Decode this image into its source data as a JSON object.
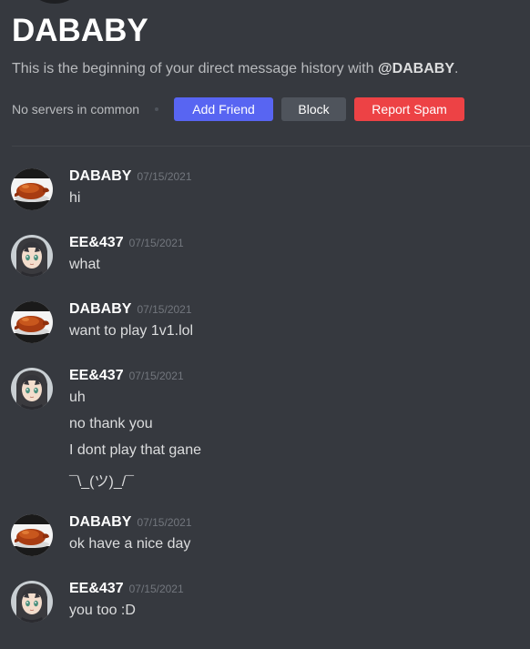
{
  "intro": {
    "title": "DABABY",
    "description_prefix": "This is the beginning of your direct message history with ",
    "mention": "@DABABY",
    "description_suffix": "."
  },
  "actions": {
    "mutual_servers": "No servers in common",
    "add_friend": "Add Friend",
    "block": "Block",
    "report_spam": "Report Spam"
  },
  "colors": {
    "background": "#36393f",
    "add_friend": "#5865f2",
    "block": "#4f545c",
    "report_spam": "#ed4245"
  },
  "messages": [
    {
      "author": "DABABY",
      "avatar": "roast-chicken-avatar",
      "timestamp": "07/15/2021",
      "lines": [
        "hi"
      ]
    },
    {
      "author": "EE&437",
      "avatar": "anime-girl-avatar",
      "timestamp": "07/15/2021",
      "lines": [
        "what"
      ]
    },
    {
      "author": "DABABY",
      "avatar": "roast-chicken-avatar",
      "timestamp": "07/15/2021",
      "lines": [
        "want to play 1v1.lol"
      ]
    },
    {
      "author": "EE&437",
      "avatar": "anime-girl-avatar",
      "timestamp": "07/15/2021",
      "lines": [
        "uh",
        "no thank you",
        "I dont play that gane",
        "¯\\_(ツ)_/¯"
      ]
    },
    {
      "author": "DABABY",
      "avatar": "roast-chicken-avatar",
      "timestamp": "07/15/2021",
      "lines": [
        "ok have a nice day"
      ]
    },
    {
      "author": "EE&437",
      "avatar": "anime-girl-avatar",
      "timestamp": "07/15/2021",
      "lines": [
        "you too :D"
      ]
    }
  ]
}
